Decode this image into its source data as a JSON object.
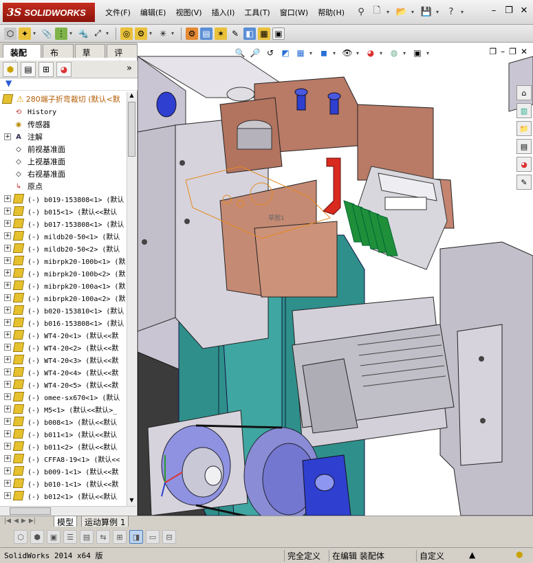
{
  "app": {
    "logo_ds": "3S",
    "logo_name": "SOLIDWORKS"
  },
  "menu": [
    "文件(F)",
    "编辑(E)",
    "视图(V)",
    "插入(I)",
    "工具(T)",
    "窗口(W)",
    "帮助(H)"
  ],
  "command_manager_tabs": [
    "装配体",
    "布局",
    "草图",
    "评估"
  ],
  "active_cm_tab": "装配体",
  "tree": {
    "root": "280端子折弯裁切  (默认<默",
    "features": [
      "History",
      "传感器",
      "注解",
      "前视基准面",
      "上视基准面",
      "右视基准面",
      "原点"
    ],
    "parts": [
      "(-) b019-153808<1> (默认",
      "(-) b015<1> (默认<<默认",
      "(-) b017-153808<1> (默认",
      "(-) mildb20-50<1> (默认",
      "(-) mildb20-50<2> (默认",
      "(-) mibrpk20-100b<1> (默",
      "(-) mibrpk20-100b<2> (默",
      "(-) mibrpk20-100a<1> (默",
      "(-) mibrpk20-100a<2> (默",
      "(-) b020-153810<1> (默认",
      "(-) b016-153808<1> (默认",
      "(-) WT4-20<1> (默认<<默",
      "(-) WT4-20<2> (默认<<默",
      "(-) WT4-20<3> (默认<<默",
      "(-) WT4-20<4> (默认<<默",
      "(-) WT4-20<5> (默认<<默",
      "(-) omee-sx670<1> (默认",
      "(-) M5<1> (默认<<默认>_",
      "(-) b008<1> (默认<<默认",
      "(-) b011<1> (默认<<默认",
      "(-) b011<2> (默认<<默认",
      "(-) CFFA8-19<1> (默认<<",
      "(-) b009-1<1> (默认<<默",
      "(-) b010-1<1> (默认<<默",
      "(-) b012<1> (默认<<默认"
    ]
  },
  "viewport": {
    "sketch_label": "草图1"
  },
  "bottom_tabs": [
    "模型",
    "运动算例 1"
  ],
  "status": {
    "version": "SolidWorks 2014 x64 版",
    "underdefined": "完全定义",
    "editing": "在编辑 装配体",
    "custom": "自定义"
  },
  "colors": {
    "sw_red": "#b0221a",
    "copper": "#b97a66",
    "teal": "#2f8f8b",
    "gray_part": "#bdb7c9",
    "blue_part": "#2f3fd0",
    "green_pcb": "#1f8f3a"
  }
}
